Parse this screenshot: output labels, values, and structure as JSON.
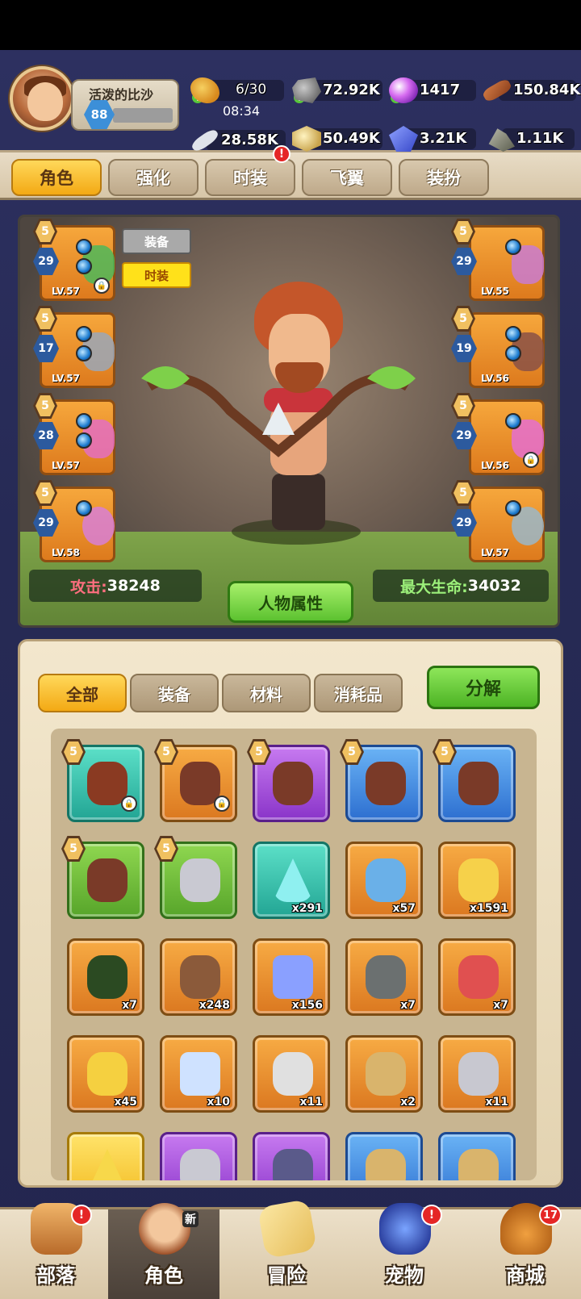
{
  "player": {
    "name": "活泼的比沙",
    "level": "88"
  },
  "resources": {
    "stamina": "6/30",
    "stamina_timer": "08:34",
    "stone": "72.92K",
    "orb": "1417",
    "wood": "150.84K",
    "bone": "28.58K",
    "sand": "50.49K",
    "gem": "3.21K",
    "ore": "1.11K"
  },
  "top_tabs": [
    {
      "label": "角色",
      "active": true
    },
    {
      "label": "强化",
      "active": false
    },
    {
      "label": "时装",
      "active": false,
      "badge": "!"
    },
    {
      "label": "飞翼",
      "active": false
    },
    {
      "label": "装扮",
      "active": false
    }
  ],
  "view_toggle": {
    "equip": "装备",
    "skin": "时装"
  },
  "equipment_left": [
    {
      "star": "5",
      "gem_level": "29",
      "lv": "LV.57",
      "locked": true
    },
    {
      "star": "5",
      "gem_level": "17",
      "lv": "LV.57",
      "locked": false
    },
    {
      "star": "5",
      "gem_level": "28",
      "lv": "LV.57",
      "locked": false
    },
    {
      "star": "5",
      "gem_level": "29",
      "lv": "LV.58",
      "locked": false
    }
  ],
  "equipment_right": [
    {
      "star": "5",
      "gem_level": "29",
      "lv": "LV.55",
      "locked": false
    },
    {
      "star": "5",
      "gem_level": "19",
      "lv": "LV.56",
      "locked": false
    },
    {
      "star": "5",
      "gem_level": "29",
      "lv": "LV.56",
      "locked": true
    },
    {
      "star": "5",
      "gem_level": "29",
      "lv": "LV.57",
      "locked": false
    }
  ],
  "stats": {
    "attack_label": "攻击:",
    "attack_value": "38248",
    "hp_label": "最大生命:",
    "hp_value": "34032",
    "attr_button": "人物属性"
  },
  "inventory": {
    "tabs": [
      {
        "label": "全部",
        "active": true
      },
      {
        "label": "装备",
        "active": false
      },
      {
        "label": "材料",
        "active": false
      },
      {
        "label": "消耗品",
        "active": false
      }
    ],
    "decompose": "分解",
    "items": [
      {
        "color": "teal",
        "star": "5",
        "count": "",
        "locked": true,
        "icon": "boot-icon"
      },
      {
        "color": "orange",
        "star": "5",
        "count": "",
        "locked": true,
        "icon": "bow-icon"
      },
      {
        "color": "purple",
        "star": "5",
        "count": "",
        "locked": false,
        "icon": "bow-icon"
      },
      {
        "color": "blue",
        "star": "5",
        "count": "",
        "locked": false,
        "icon": "bow-icon"
      },
      {
        "color": "blue",
        "star": "5",
        "count": "",
        "locked": false,
        "icon": "bow-icon"
      },
      {
        "color": "green",
        "star": "5",
        "count": "",
        "locked": false,
        "icon": "bow-icon"
      },
      {
        "color": "green",
        "star": "5",
        "count": "",
        "locked": false,
        "icon": "crown-icon"
      },
      {
        "color": "teal",
        "star": "",
        "count": "x291",
        "locked": false,
        "icon": "crystal-icon"
      },
      {
        "color": "orange",
        "star": "",
        "count": "x57",
        "locked": false,
        "icon": "key-icon"
      },
      {
        "color": "orange",
        "star": "",
        "count": "x1591",
        "locked": false,
        "icon": "potion-icon"
      },
      {
        "color": "orange",
        "star": "",
        "count": "x7",
        "locked": false,
        "icon": "flask-icon"
      },
      {
        "color": "orange",
        "star": "",
        "count": "x248",
        "locked": false,
        "icon": "hammer-icon"
      },
      {
        "color": "orange",
        "star": "",
        "count": "x156",
        "locked": false,
        "icon": "gem-icon"
      },
      {
        "color": "orange",
        "star": "",
        "count": "x7",
        "locked": false,
        "icon": "rune-icon"
      },
      {
        "color": "orange",
        "star": "",
        "count": "x7",
        "locked": false,
        "icon": "shard-icon"
      },
      {
        "color": "orange",
        "star": "",
        "count": "x45",
        "locked": false,
        "icon": "star-icon"
      },
      {
        "color": "orange",
        "star": "",
        "count": "x10",
        "locked": false,
        "icon": "diamond-icon"
      },
      {
        "color": "orange",
        "star": "",
        "count": "x11",
        "locked": false,
        "icon": "tube-icon"
      },
      {
        "color": "orange",
        "star": "",
        "count": "x2",
        "locked": false,
        "icon": "scroll-icon"
      },
      {
        "color": "orange",
        "star": "",
        "count": "x11",
        "locked": false,
        "icon": "ingot-icon"
      },
      {
        "color": "yellow",
        "star": "",
        "count": "",
        "locked": false,
        "icon": "pyramid-icon"
      },
      {
        "color": "purple",
        "star": "",
        "count": "",
        "locked": false,
        "icon": "crown-icon"
      },
      {
        "color": "purple",
        "star": "",
        "count": "",
        "locked": false,
        "icon": "cube-icon"
      },
      {
        "color": "blue",
        "star": "",
        "count": "",
        "locked": false,
        "icon": "scroll-icon"
      },
      {
        "color": "blue",
        "star": "",
        "count": "",
        "locked": false,
        "icon": "scroll-icon"
      }
    ]
  },
  "bottom_nav": [
    {
      "label": "部落",
      "badge": "!",
      "active": false
    },
    {
      "label": "角色",
      "tag": "新",
      "active": true
    },
    {
      "label": "冒险",
      "active": false
    },
    {
      "label": "宠物",
      "badge": "!",
      "active": false
    },
    {
      "label": "商城",
      "badge": "17",
      "active": false
    }
  ],
  "colors": {
    "accent_gold": "#f3a914",
    "accent_green": "#5cc230",
    "attack_red": "#ff6e7f",
    "hp_green": "#9cf07a",
    "badge_red": "#e52626"
  }
}
